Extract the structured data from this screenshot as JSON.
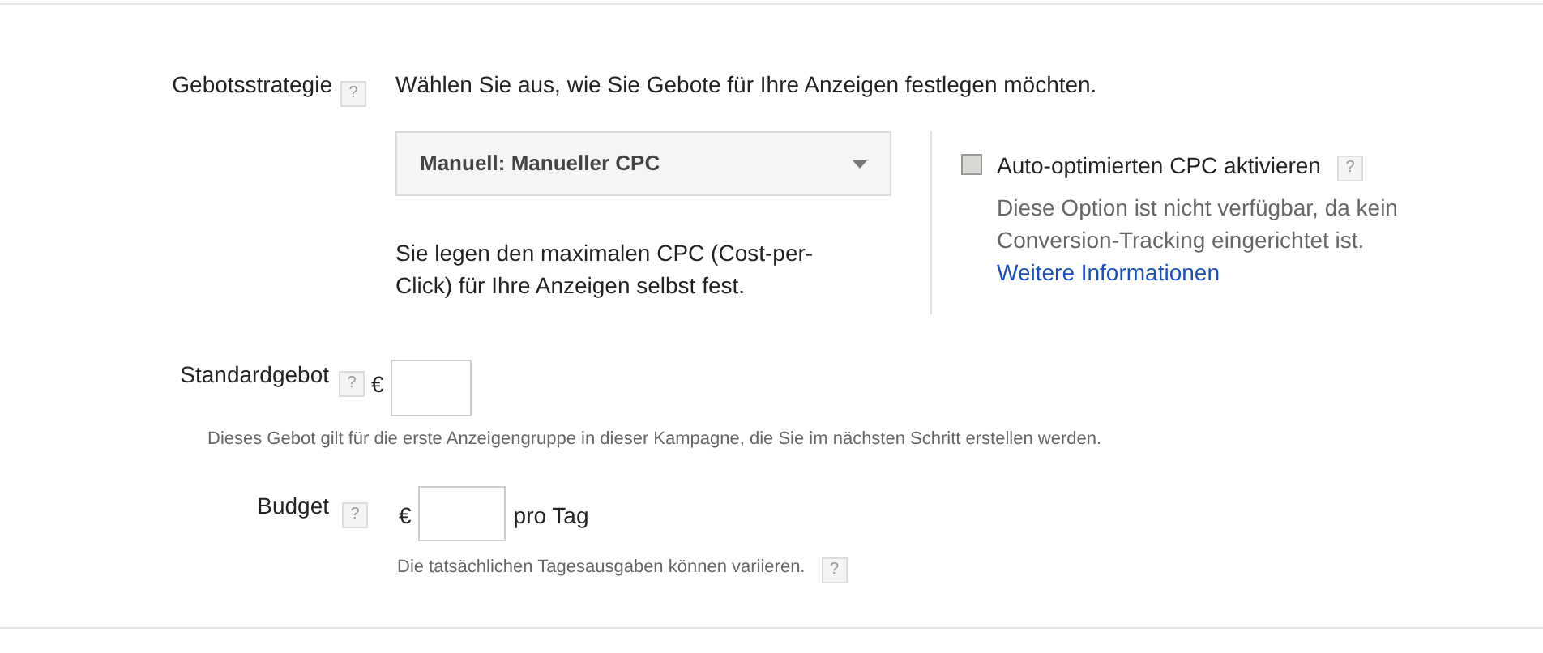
{
  "bid_strategy": {
    "label": "Gebotsstrategie",
    "help": "?",
    "intro": "Wählen Sie aus, wie Sie Gebote für Ihre Anzeigen festlegen möchten.",
    "dropdown": {
      "value": "Manuell: Manueller CPC"
    },
    "description": "Sie legen den maximalen CPC (Cost-per-Click) für Ihre Anzeigen selbst fest.",
    "auto_cpc": {
      "label": "Auto-optimierten CPC aktivieren",
      "help": "?",
      "checked": false,
      "disabled": true,
      "note": "Diese Option ist nicht verfügbar, da kein Conversion-Tracking eingerichtet ist.",
      "link": "Weitere Informationen"
    }
  },
  "default_bid": {
    "label": "Standardgebot",
    "help": "?",
    "currency": "€",
    "hint": "Dieses Gebot gilt für die erste Anzeigengruppe in dieser Kampagne, die Sie im nächsten Schritt erstellen werden."
  },
  "budget": {
    "label": "Budget",
    "help": "?",
    "currency": "€",
    "unit": "pro Tag",
    "hint": "Die tatsächlichen Tagesausgaben können variieren.",
    "hint_help": "?"
  }
}
